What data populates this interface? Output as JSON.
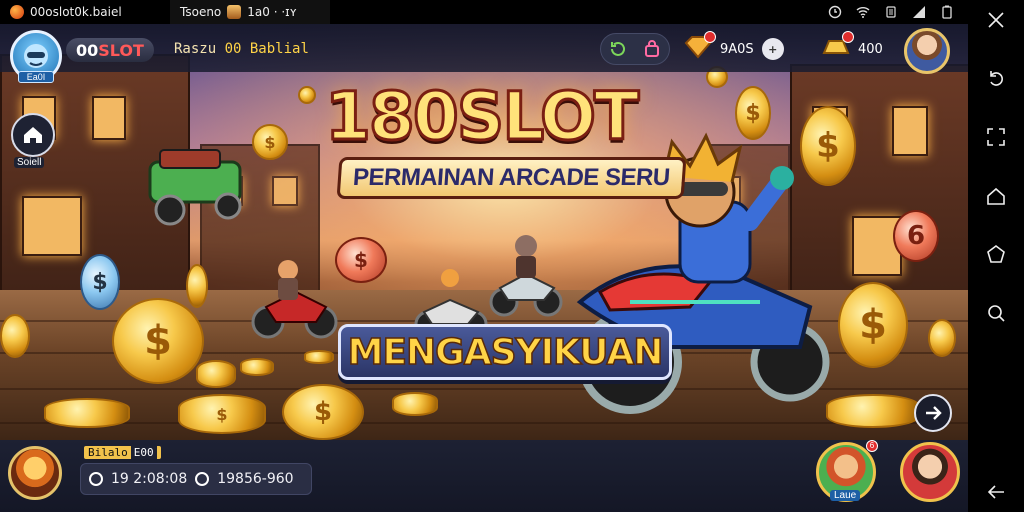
{
  "status_bar": {
    "tab1_title": "00oslot0k.baiel",
    "tab2_title": "Tsoeno",
    "tab2_extra": "1a0 · ·ɪʏ"
  },
  "hud_top": {
    "level_tag": "Ea0I",
    "brand": {
      "prefix": "00",
      "accent": "SLOT"
    },
    "nick_prefix": "Raszu",
    "nick_gold": "00 Bablial",
    "gems": "9A0S",
    "gold": "400"
  },
  "side": {
    "home_label": "Soiell"
  },
  "banner": {
    "title": "180SLOT",
    "subtitle": "PERMAINAN ARCADE SERU",
    "cta": "MENGASYIKUAN"
  },
  "hud_bottom": {
    "player_tag": "Bilalo",
    "player_level": "E00",
    "stat1": "19 2:08:08",
    "stat2": "19856-960",
    "friend1_label": "Laue",
    "friend1_badge": "6"
  },
  "colors": {
    "accent_red": "#ff5959",
    "gold": "#ffd447",
    "hud_bg": "#1d2133"
  }
}
